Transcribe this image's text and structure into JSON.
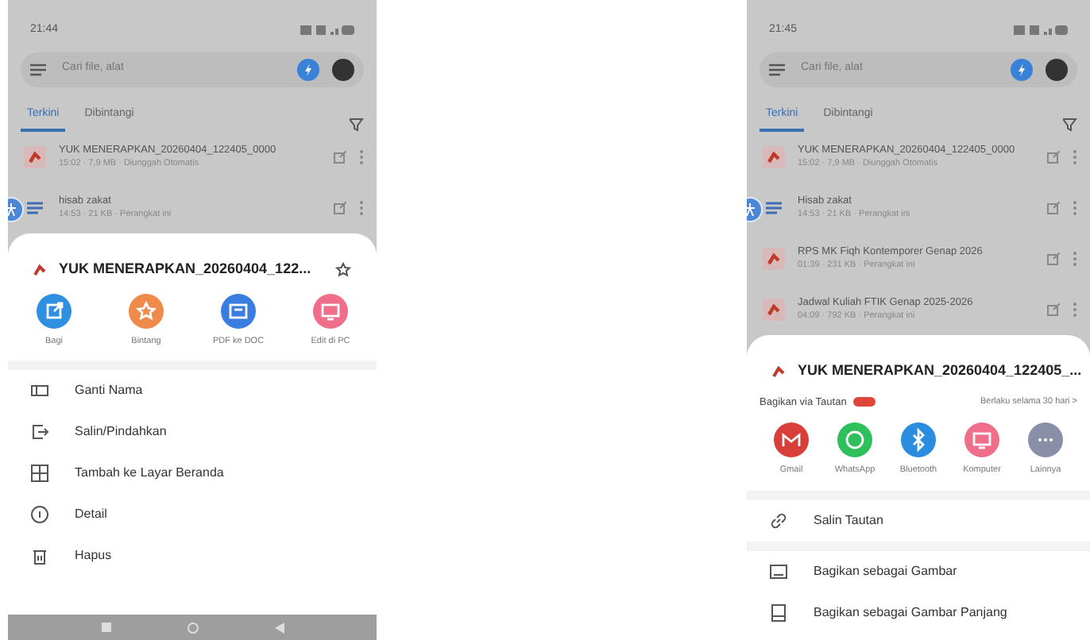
{
  "phones": [
    {
      "status_time": "21:44",
      "search": {
        "placeholder": "Cari file, alat"
      },
      "tabs": [
        {
          "label": "Terkini",
          "selected": true
        },
        {
          "label": "Dibintangi",
          "selected": false
        }
      ],
      "files": [
        {
          "kind": "pdf",
          "name": "YUK MENERAPKAN_20260404_122405_0000",
          "meta": "15:02 · 7,9 MB · Diunggah Otomatis"
        },
        {
          "kind": "doc",
          "name": "hisab zakat",
          "meta": "14:53 · 21 KB · Perangkat ini"
        }
      ],
      "sheet": {
        "title": "YUK MENERAPKAN_20260404_122...",
        "actions": [
          {
            "kind": "share",
            "label": "Bagi",
            "color": "#2f8fe0"
          },
          {
            "kind": "star",
            "label": "Bintang",
            "color": "#f08a4b"
          },
          {
            "kind": "convert",
            "label": "PDF ke DOC",
            "color": "#3a7de0"
          },
          {
            "kind": "monitor",
            "label": "Edit di PC",
            "color": "#ef6f8a"
          }
        ],
        "menu": [
          {
            "kind": "rename",
            "label": "Ganti Nama"
          },
          {
            "kind": "move",
            "label": "Salin/Pindahkan"
          },
          {
            "kind": "add",
            "label": "Tambah ke Layar Beranda"
          },
          {
            "kind": "info",
            "label": "Detail"
          },
          {
            "kind": "trash",
            "label": "Hapus"
          }
        ]
      },
      "nav_bar": true
    },
    {
      "status_time": "21:45",
      "search": {
        "placeholder": "Cari file, alat"
      },
      "tabs": [
        {
          "label": "Terkini",
          "selected": true
        },
        {
          "label": "Dibintangi",
          "selected": false
        }
      ],
      "files": [
        {
          "kind": "pdf",
          "name": "YUK MENERAPKAN_20260404_122405_0000",
          "meta": "15:02 · 7,9 MB · Diunggah Otomatis"
        },
        {
          "kind": "doc",
          "name": "Hisab zakat",
          "meta": "14:53 · 21 KB · Perangkat ini"
        },
        {
          "kind": "pdf",
          "name": "RPS MK Fiqh Kontemporer Genap 2026",
          "meta": "01:39 · 231 KB · Perangkat ini"
        },
        {
          "kind": "pdf",
          "name": "Jadwal Kuliah FTIK Genap 2025-2026",
          "meta": "04:09 · 792 KB · Perangkat ini"
        }
      ],
      "sheet": {
        "title": "YUK MENERAPKAN_20260404_122405_...",
        "share": {
          "label": "Bagikan via Tautan",
          "note": "Berlaku selama 30 hari >",
          "apps": [
            {
              "kind": "mail",
              "label": "Gmail",
              "color": "#d93f3a"
            },
            {
              "kind": "chat",
              "label": "WhatsApp",
              "color": "#2fbf5b"
            },
            {
              "kind": "bluetooth",
              "label": "Bluetooth",
              "color": "#2b8de0"
            },
            {
              "kind": "monitor",
              "label": "Komputer",
              "color": "#ef6f8a"
            },
            {
              "kind": "more",
              "label": "Lainnya",
              "color": "#8a8fa8"
            }
          ]
        },
        "menu": [
          {
            "kind": "link",
            "label": "Salin Tautan"
          },
          {
            "kind": "image",
            "label": "Bagikan sebagai Gambar"
          },
          {
            "kind": "longimage",
            "label": "Bagikan sebagai Gambar Panjang"
          }
        ]
      },
      "nav_bar": false
    }
  ]
}
